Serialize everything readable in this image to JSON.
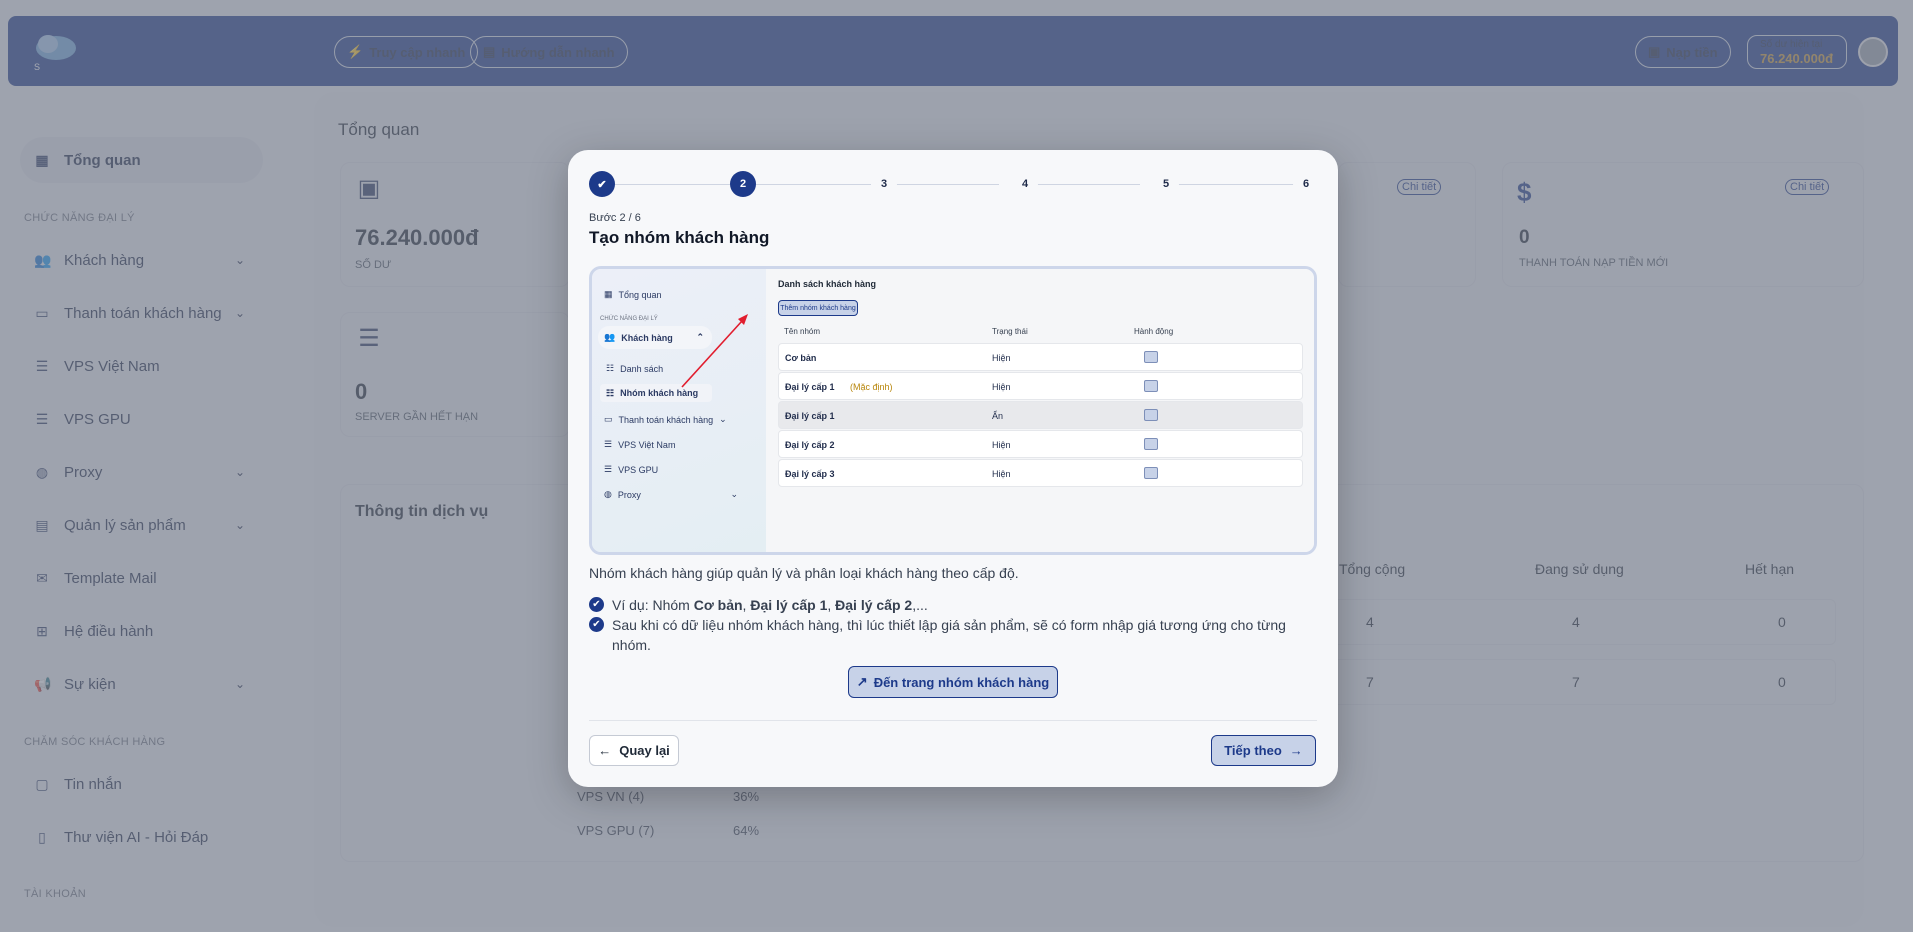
{
  "header": {
    "quick_access": "Truy cập nhanh",
    "quick_guide": "Hướng dẫn nhanh",
    "topup": "Nạp tiền",
    "balance_label": "Số dư hiện tại",
    "balance_value": "76.240.000đ"
  },
  "sidebar": {
    "overview": "Tổng quan",
    "section_agent": "CHỨC NĂNG ĐẠI LÝ",
    "items": [
      "Khách hàng",
      "Thanh toán khách hàng",
      "VPS Việt Nam",
      "VPS GPU",
      "Proxy",
      "Quản lý sản phẩm",
      "Template Mail",
      "Hệ điều hành",
      "Sự kiện"
    ],
    "section_care": "CHĂM SÓC KHÁCH HÀNG",
    "care_items": [
      "Tin nhắn",
      "Thư viện AI - Hỏi Đáp"
    ],
    "section_account": "TÀI KHOẢN"
  },
  "main": {
    "title": "Tổng quan",
    "balance_value": "76.240.000đ",
    "balance_label": "SỐ DƯ",
    "server_value": "0",
    "server_label": "SERVER GẦN HẾT HẠN",
    "detail": "Chi tiết",
    "topup_value": "0",
    "topup_label": "THANH TOÁN NẠP TIỀN MỚI",
    "service_title": "Thông tin dịch vụ",
    "table_headers": [
      "Tổng cộng",
      "Đang sử dụng",
      "Hết hạn"
    ],
    "table_rows": [
      [
        "4",
        "4",
        "0"
      ],
      [
        "7",
        "7",
        "0"
      ]
    ],
    "legend": [
      {
        "name": "VPS VN (4)",
        "pct": "36%"
      },
      {
        "name": "VPS GPU (7)",
        "pct": "64%"
      }
    ]
  },
  "modal": {
    "steps": [
      "2",
      "3",
      "4",
      "5",
      "6"
    ],
    "step_label": "Bước 2 / 6",
    "title": "Tạo nhóm khách hàng",
    "description": "Nhóm khách hàng giúp quản lý và phân loại khách hàng theo cấp độ.",
    "bullet1_prefix": "Ví dụ: Nhóm ",
    "bullet1_b1": "Cơ bản",
    "bullet1_sep1": ", ",
    "bullet1_b2": "Đại lý cấp 1",
    "bullet1_sep2": ", ",
    "bullet1_b3": "Đại lý cấp 2",
    "bullet1_suffix": ",...",
    "bullet2": "Sau khi có dữ liệu nhóm khách hàng, thì lúc thiết lập giá sản phẩm, sẽ có form nhập giá tương ứng cho từng nhóm.",
    "link_button": "Đến trang nhóm khách hàng",
    "back": "Quay lại",
    "next": "Tiếp theo",
    "preview": {
      "side_overview": "Tổng quan",
      "side_section": "CHỨC NĂNG ĐẠI LÝ",
      "side_customers": "Khách hàng",
      "side_list": "Danh sách",
      "side_groups": "Nhóm khách hàng",
      "side_payment": "Thanh toán khách hàng",
      "side_vpsvn": "VPS Việt Nam",
      "side_gpu": "VPS GPU",
      "side_proxy": "Proxy",
      "list_title": "Danh sách khách hàng",
      "add_button": "Thêm nhóm khách hàng",
      "col_name": "Tên nhóm",
      "col_status": "Trạng thái",
      "col_action": "Hành động",
      "rows": [
        {
          "name": "Cơ bản",
          "tag": "",
          "status": "Hiện"
        },
        {
          "name": "Đại lý cấp 1",
          "tag": "(Mặc định)",
          "status": "Hiện"
        },
        {
          "name": "Đại lý cấp 1",
          "tag": "",
          "status": "Ẩn"
        },
        {
          "name": "Đại lý cấp 2",
          "tag": "",
          "status": "Hiện"
        },
        {
          "name": "Đại lý cấp 3",
          "tag": "",
          "status": "Hiện"
        }
      ]
    }
  }
}
